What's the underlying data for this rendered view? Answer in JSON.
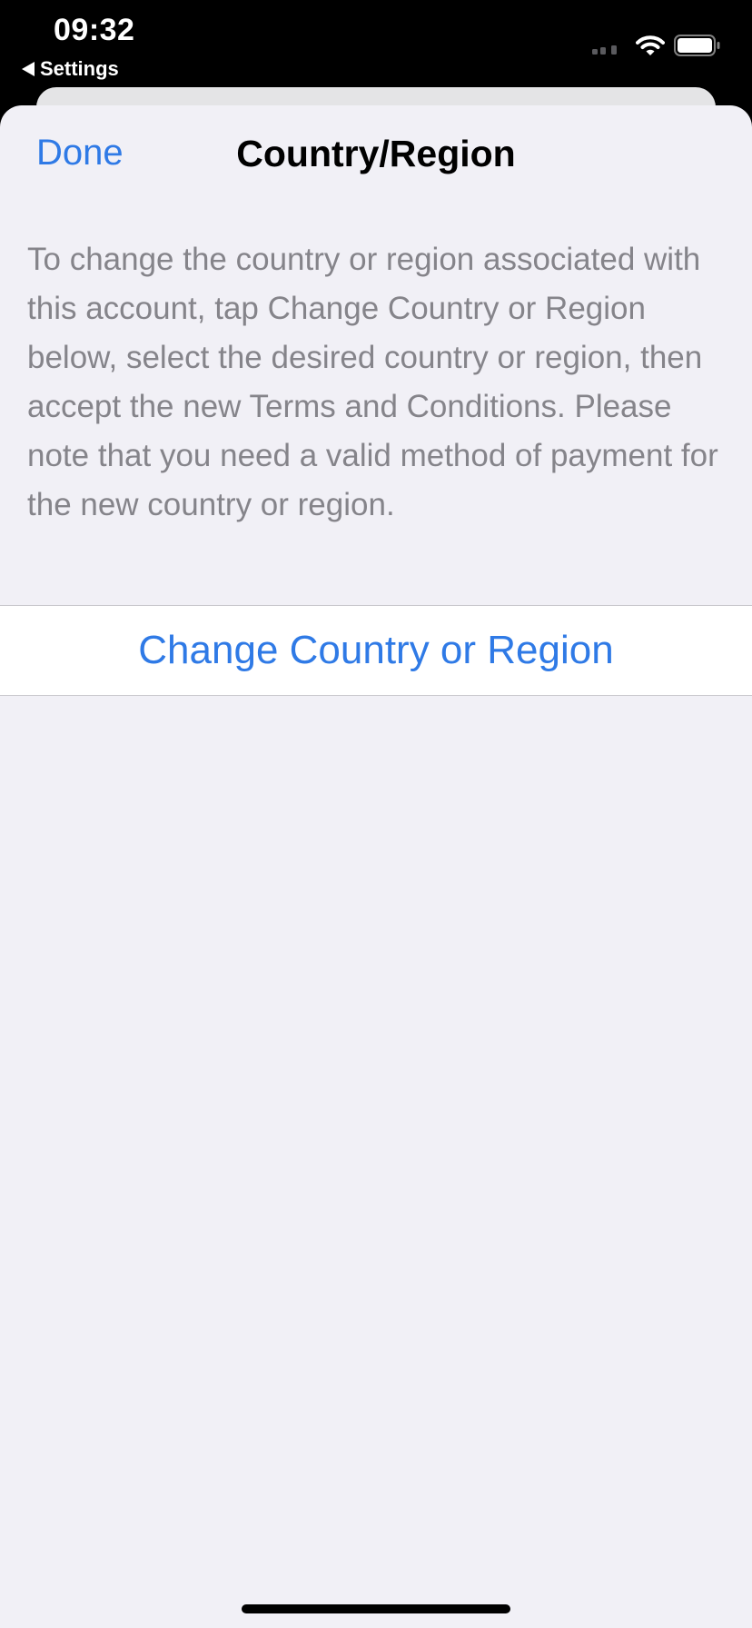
{
  "status_bar": {
    "time": "09:32",
    "back_label": "Settings",
    "icons": [
      "signal-icon",
      "wifi-icon",
      "battery-icon"
    ]
  },
  "nav": {
    "done_label": "Done",
    "title": "Country/Region"
  },
  "content": {
    "description": "To change the country or region associated with this account, tap Change Country or Region below, select the desired country or region, then accept the new Terms and Conditions. Please note that you need a valid method of payment for the new country or region.",
    "action_label": "Change Country or Region"
  },
  "colors": {
    "accent": "#2f7ae6",
    "sheet_background": "#f1f0f6",
    "secondary_text": "#85848a",
    "status_bar_background": "#000000"
  }
}
